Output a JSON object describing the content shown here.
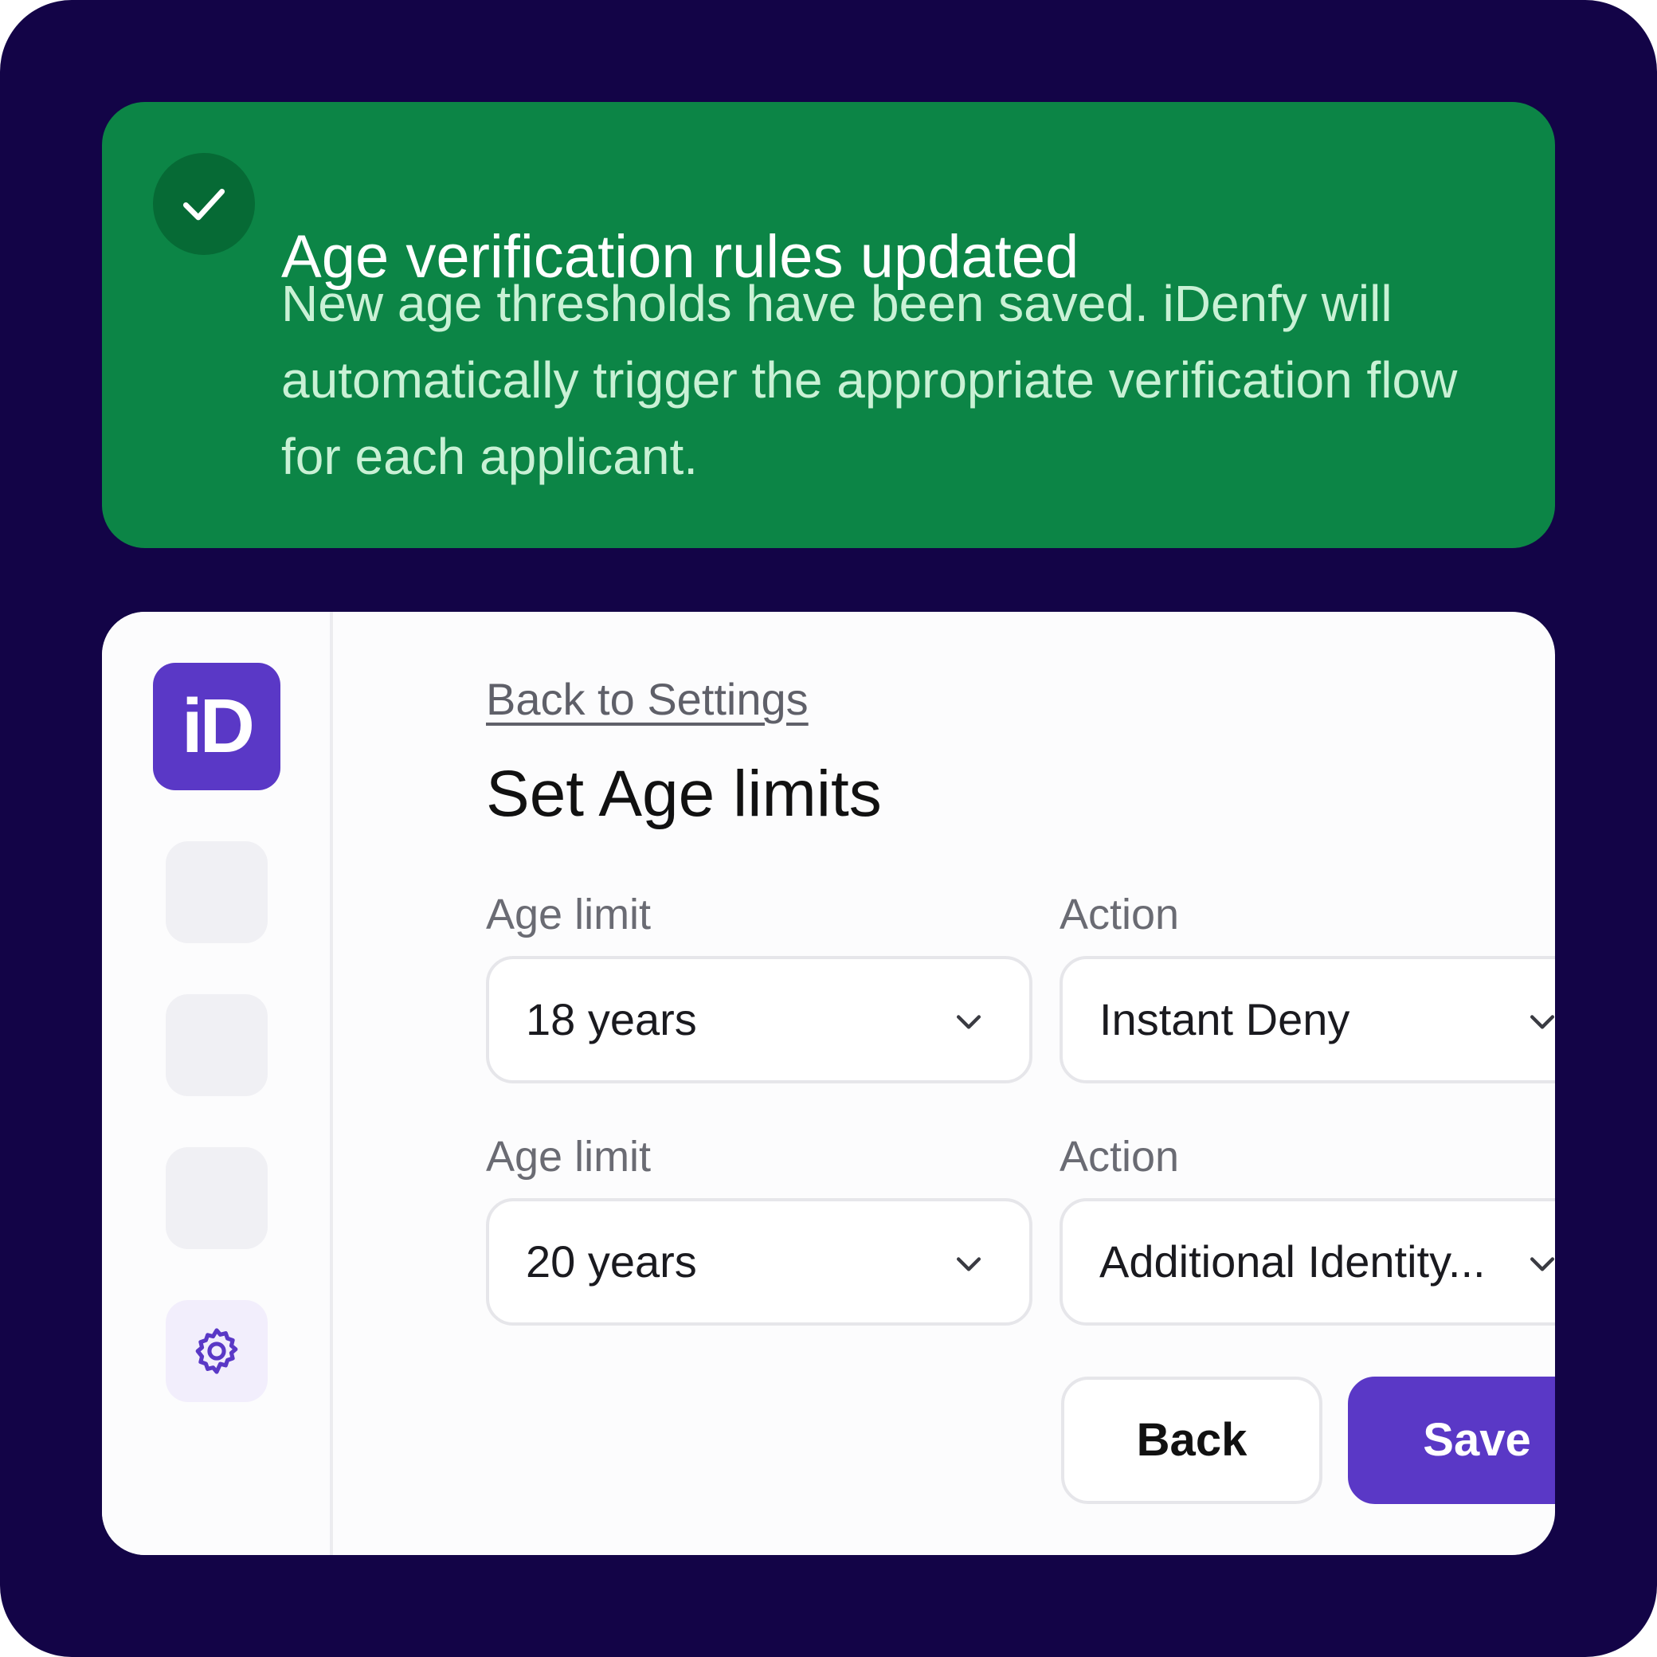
{
  "toast": {
    "title": "Age verification rules updated",
    "message": "New age thresholds have been saved. iDenfy will automatically trigger the appropriate verification flow for each applicant.",
    "icon": "check-icon",
    "color": "#0c8546"
  },
  "sidebar": {
    "logo_text": "iD",
    "logo_color": "#5a38c6",
    "settings_icon": "gear-icon"
  },
  "main": {
    "back_link": "Back to Settings",
    "title": "Set Age limits",
    "rules": [
      {
        "age_label": "Age limit",
        "age_value": "18 years",
        "action_label": "Action",
        "action_value": "Instant Deny"
      },
      {
        "age_label": "Age limit",
        "age_value": "20 years",
        "action_label": "Action",
        "action_value": "Additional Identity..."
      }
    ],
    "back_button": "Back",
    "save_button": "Save",
    "accent_color": "#5a38c6"
  },
  "background_color": "#130447"
}
